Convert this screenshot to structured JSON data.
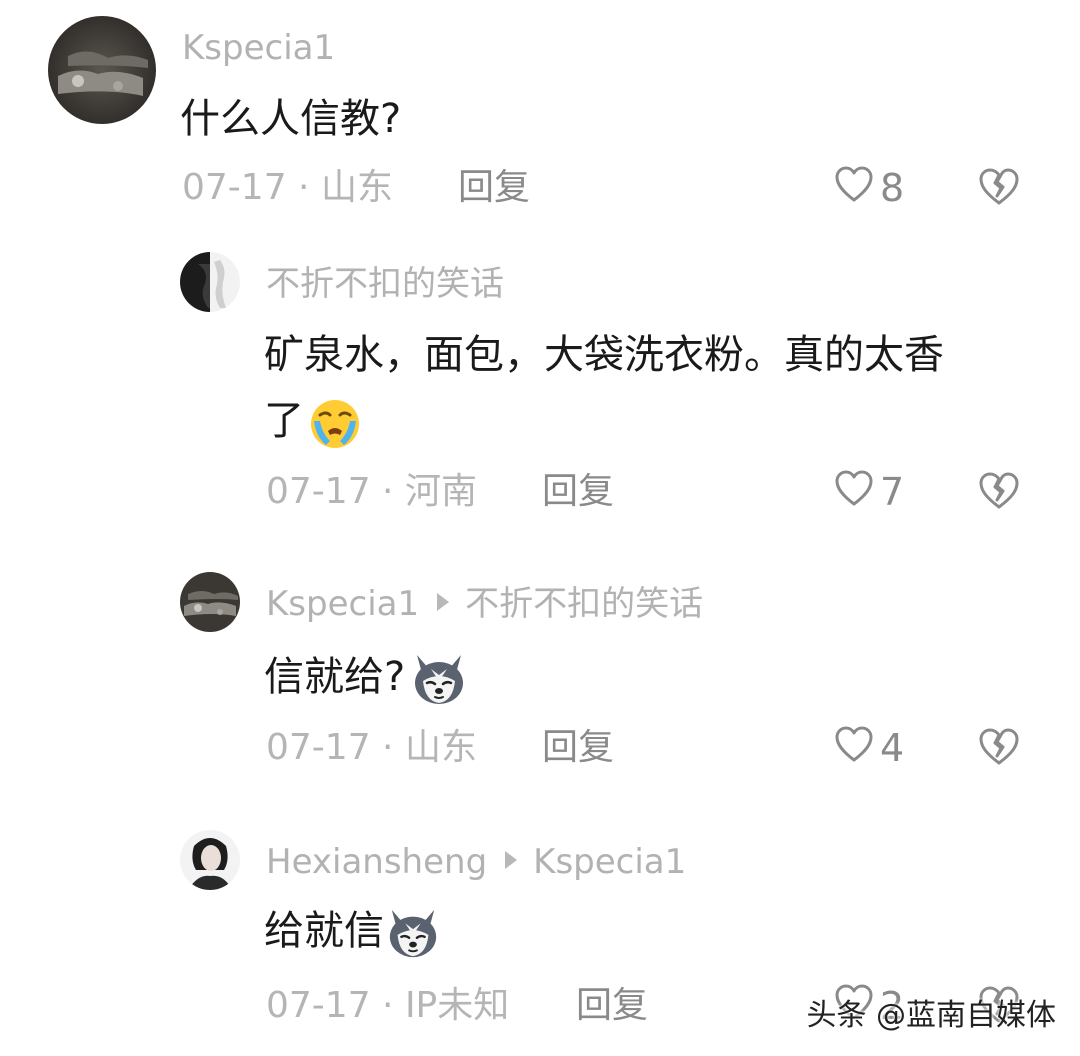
{
  "comments": [
    {
      "username": "Kspecia1",
      "text": "什么人信教?",
      "date": "07-17 · 山东",
      "reply_label": "回复",
      "likes": "8"
    },
    {
      "username": "不折不扣的笑话",
      "text_line1": "矿泉水，面包，大袋洗衣粉。真的太香",
      "text_line2": "了",
      "date": "07-17 · 河南",
      "reply_label": "回复",
      "likes": "7"
    },
    {
      "username": "Kspecia1",
      "reply_to": "不折不扣的笑话",
      "text": "信就给?",
      "date": "07-17 · 山东",
      "reply_label": "回复",
      "likes": "4"
    },
    {
      "username": "Hexiansheng",
      "reply_to": "Kspecia1",
      "text": "给就信",
      "date": "07-17 · IP未知",
      "reply_label": "回复",
      "likes": "2"
    }
  ],
  "watermark": "头条 @蓝南自媒体",
  "icons": {
    "like": "heart-outline-icon",
    "dislike": "broken-heart-icon",
    "emoji_crying": "loudly-crying-face-emoji",
    "emoji_husky": "husky-dog-emoji"
  },
  "colors": {
    "username": "#b2b2b2",
    "text": "#1a1a1a",
    "meta": "#b5b5b5"
  }
}
